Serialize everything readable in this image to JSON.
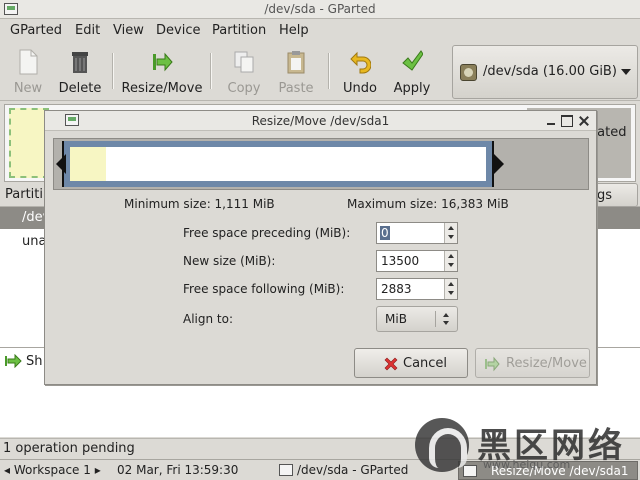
{
  "window": {
    "title": "/dev/sda - GParted"
  },
  "menu": [
    {
      "label": "GParted"
    },
    {
      "label": "Edit"
    },
    {
      "label": "View"
    },
    {
      "label": "Device"
    },
    {
      "label": "Partition"
    },
    {
      "label": "Help"
    }
  ],
  "toolbar": {
    "new": "New",
    "delete": "Delete",
    "resize_move": "Resize/Move",
    "copy": "Copy",
    "paste": "Paste",
    "undo": "Undo",
    "apply": "Apply"
  },
  "device_selector": {
    "value": "/dev/sda  (16.00 GiB)"
  },
  "disk_map": {
    "unallocated_text": "cated"
  },
  "partition_list": {
    "header": "Partiti",
    "right_button": "gs",
    "rows": [
      {
        "partition": "/dev"
      },
      {
        "partition": "una"
      }
    ]
  },
  "operations": {
    "item": "Sh"
  },
  "status": {
    "text": "1 operation pending"
  },
  "taskbar": {
    "workspace": "Workspace 1",
    "clock": "02 Mar, Fri 13:59:30",
    "tasks": [
      {
        "label": "/dev/sda - GParted"
      },
      {
        "label": "Resize/Move /dev/sda1"
      }
    ]
  },
  "watermark": {
    "big": "黑区网络",
    "small": "www.heiqu.com"
  },
  "dialog": {
    "title": "Resize/Move /dev/sda1",
    "min_size": "Minimum size: 1,111 MiB",
    "max_size": "Maximum size: 16,383 MiB",
    "fields": {
      "free_preceding": {
        "label": "Free space preceding (MiB):",
        "value": "0"
      },
      "new_size": {
        "label": "New size (MiB):",
        "value": "13500"
      },
      "free_following": {
        "label": "Free space following (MiB):",
        "value": "2883"
      },
      "align": {
        "label": "Align to:",
        "value": "MiB"
      }
    },
    "cancel": "Cancel",
    "resize_move": "Resize/Move",
    "partition_bar": {
      "used_fraction": 0.087,
      "new_size_fraction": 0.824
    }
  },
  "colors": {
    "partition_fill": "#f7f6c3",
    "partition_border": "#6e88a8",
    "selection": "#8d8b86",
    "unallocated": "#b8b6b0"
  }
}
